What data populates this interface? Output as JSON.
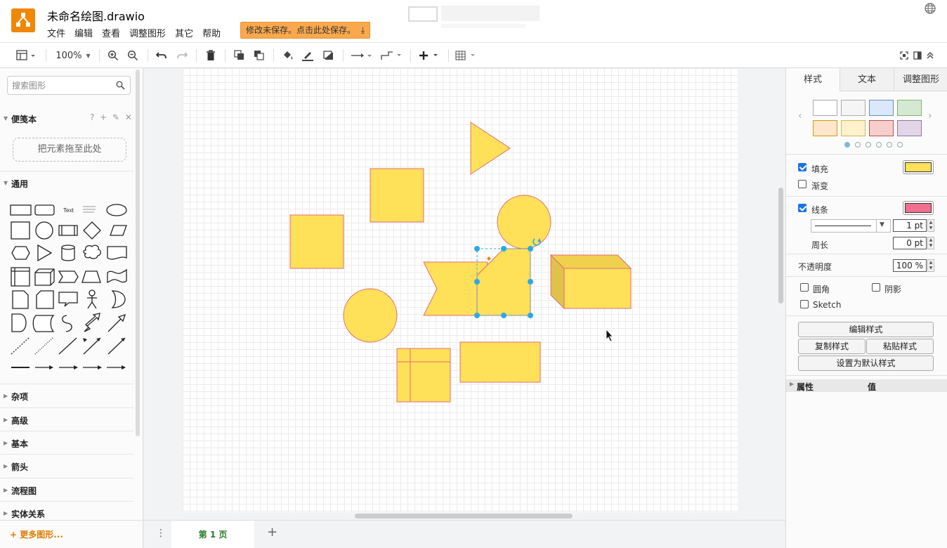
{
  "app": {
    "title": "未命名绘图.drawio",
    "menu": [
      "文件",
      "编辑",
      "查看",
      "调整图形",
      "其它",
      "帮助"
    ],
    "unsaved_notice": "修改未保存。点击此处保存。",
    "colors": {
      "accent": "#f08705",
      "shape_fill": "#ffe059",
      "shape_stroke": "#e06c7a",
      "selection": "#29a9e8"
    }
  },
  "toolbar": {
    "zoom": "100%",
    "icons": [
      "view-panels-icon",
      "zoom-in-icon",
      "zoom-out-icon",
      "undo-icon",
      "redo-icon",
      "delete-icon",
      "to-front-icon",
      "to-back-icon",
      "fill-color-icon",
      "line-color-icon",
      "shadow-icon",
      "connection-icon",
      "waypoints-icon",
      "insert-icon",
      "table-icon",
      "fullscreen-icon",
      "format-panel-icon",
      "collapse-icon"
    ]
  },
  "sidebar": {
    "search_placeholder": "搜索图形",
    "scratchpad": {
      "title": "便笺本",
      "actions": "? + ✎ ✕",
      "drop_hint": "把元素拖至此处"
    },
    "general": {
      "title": "通用",
      "text_shape_label": "Text"
    },
    "sections": [
      "杂项",
      "高级",
      "基本",
      "箭头",
      "流程图",
      "实体关系"
    ],
    "more_shapes": "+ 更多图形..."
  },
  "pages": {
    "current": "第 1 页"
  },
  "format_panel": {
    "tabs": [
      "样式",
      "文本",
      "调整图形"
    ],
    "swatches": [
      "#ffffff",
      "#f5f5f5",
      "#dae8fc",
      "#d5e8d4",
      "#ffe6cc",
      "#fff2cc",
      "#f8cecc",
      "#e1d5e7"
    ],
    "fill": {
      "label": "填充",
      "checked": true,
      "color": "#ffe059"
    },
    "gradient": {
      "label": "渐变",
      "checked": false
    },
    "line": {
      "label": "线条",
      "checked": true,
      "color": "#f07090",
      "width": "1 pt"
    },
    "perimeter": {
      "label": "周长",
      "value": "0 pt"
    },
    "opacity": {
      "label": "不透明度",
      "value": "100 %"
    },
    "rounded": "圆角",
    "shadow": "阴影",
    "sketch": "Sketch",
    "buttons": {
      "edit_style": "编辑样式",
      "copy_style": "复制样式",
      "paste_style": "粘贴样式",
      "set_default": "设置为默认样式"
    },
    "properties": {
      "col1": "属性",
      "col2": "值"
    }
  }
}
